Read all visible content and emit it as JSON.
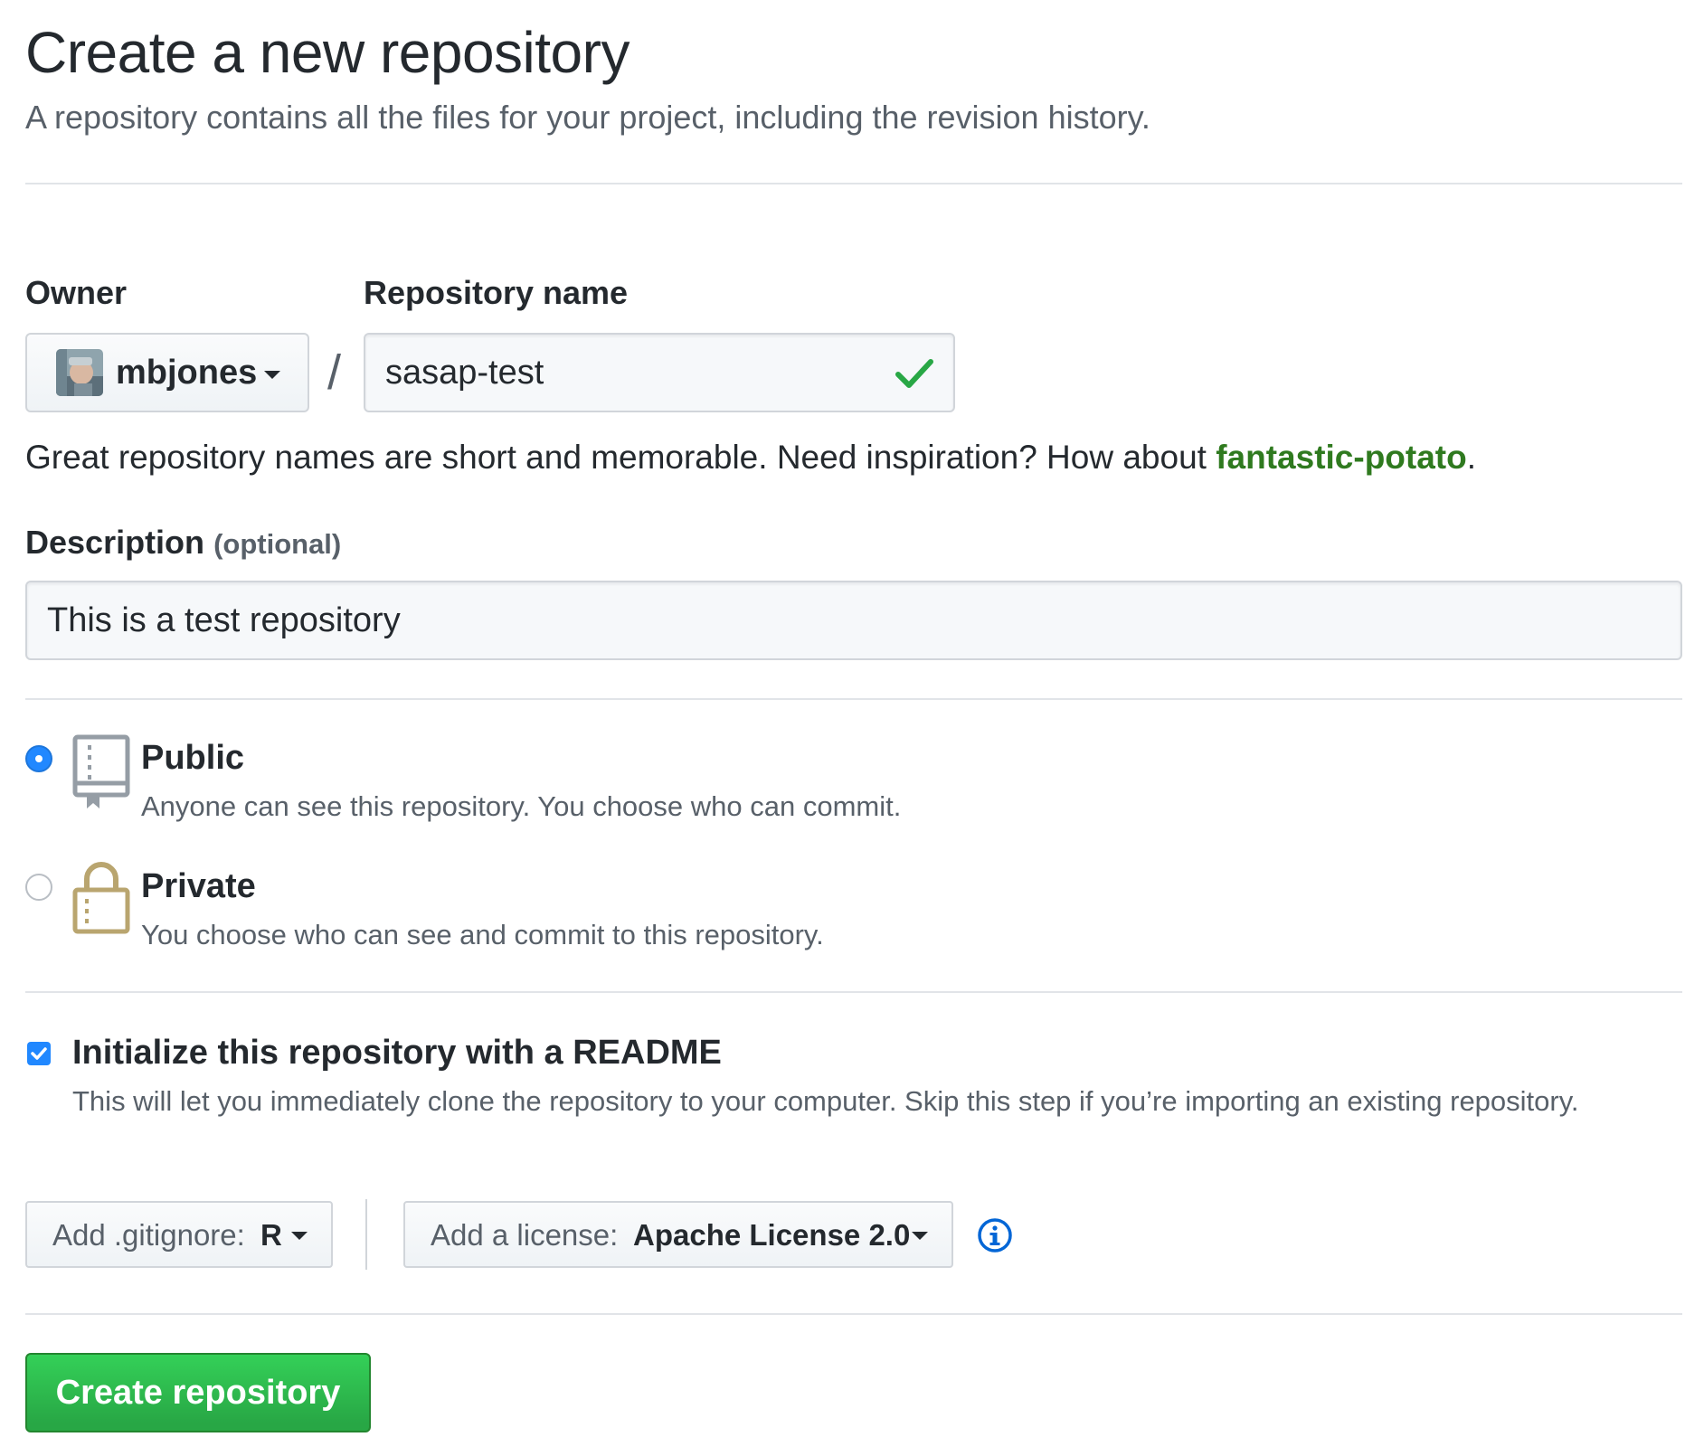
{
  "header": {
    "title": "Create a new repository",
    "subtitle": "A repository contains all the files for your project, including the revision history."
  },
  "owner": {
    "label": "Owner",
    "value": "mbjones",
    "avatar_icon": "user-avatar"
  },
  "separator": "/",
  "repo_name": {
    "label": "Repository name",
    "value": "sasap-test",
    "status_icon": "check-icon",
    "status_color": "#28a745"
  },
  "name_hint": {
    "text": "Great repository names are short and memorable. Need inspiration? How about ",
    "suggestion": "fantastic-potato",
    "suffix": "."
  },
  "description": {
    "label": "Description",
    "optional": "(optional)",
    "value": "This is a test repository"
  },
  "visibility": {
    "selected": "public",
    "options": [
      {
        "id": "public",
        "title": "Public",
        "description": "Anyone can see this repository. You choose who can commit.",
        "icon": "repo-book-icon"
      },
      {
        "id": "private",
        "title": "Private",
        "description": "You choose who can see and commit to this repository.",
        "icon": "lock-icon"
      }
    ]
  },
  "readme": {
    "checked": true,
    "title": "Initialize this repository with a README",
    "description": "This will let you immediately clone the repository to your computer. Skip this step if you’re importing an existing repository."
  },
  "gitignore": {
    "prefix": "Add .gitignore:",
    "value": "R"
  },
  "license": {
    "prefix": "Add a license:",
    "value": "Apache License 2.0",
    "info_icon": "info-icon"
  },
  "submit": {
    "label": "Create repository",
    "color": "#28a745"
  },
  "colors": {
    "accent_blue": "#2188ff",
    "link_green": "#2f7a1f",
    "muted_text": "#586069",
    "lock_gold": "#b9a56f"
  }
}
